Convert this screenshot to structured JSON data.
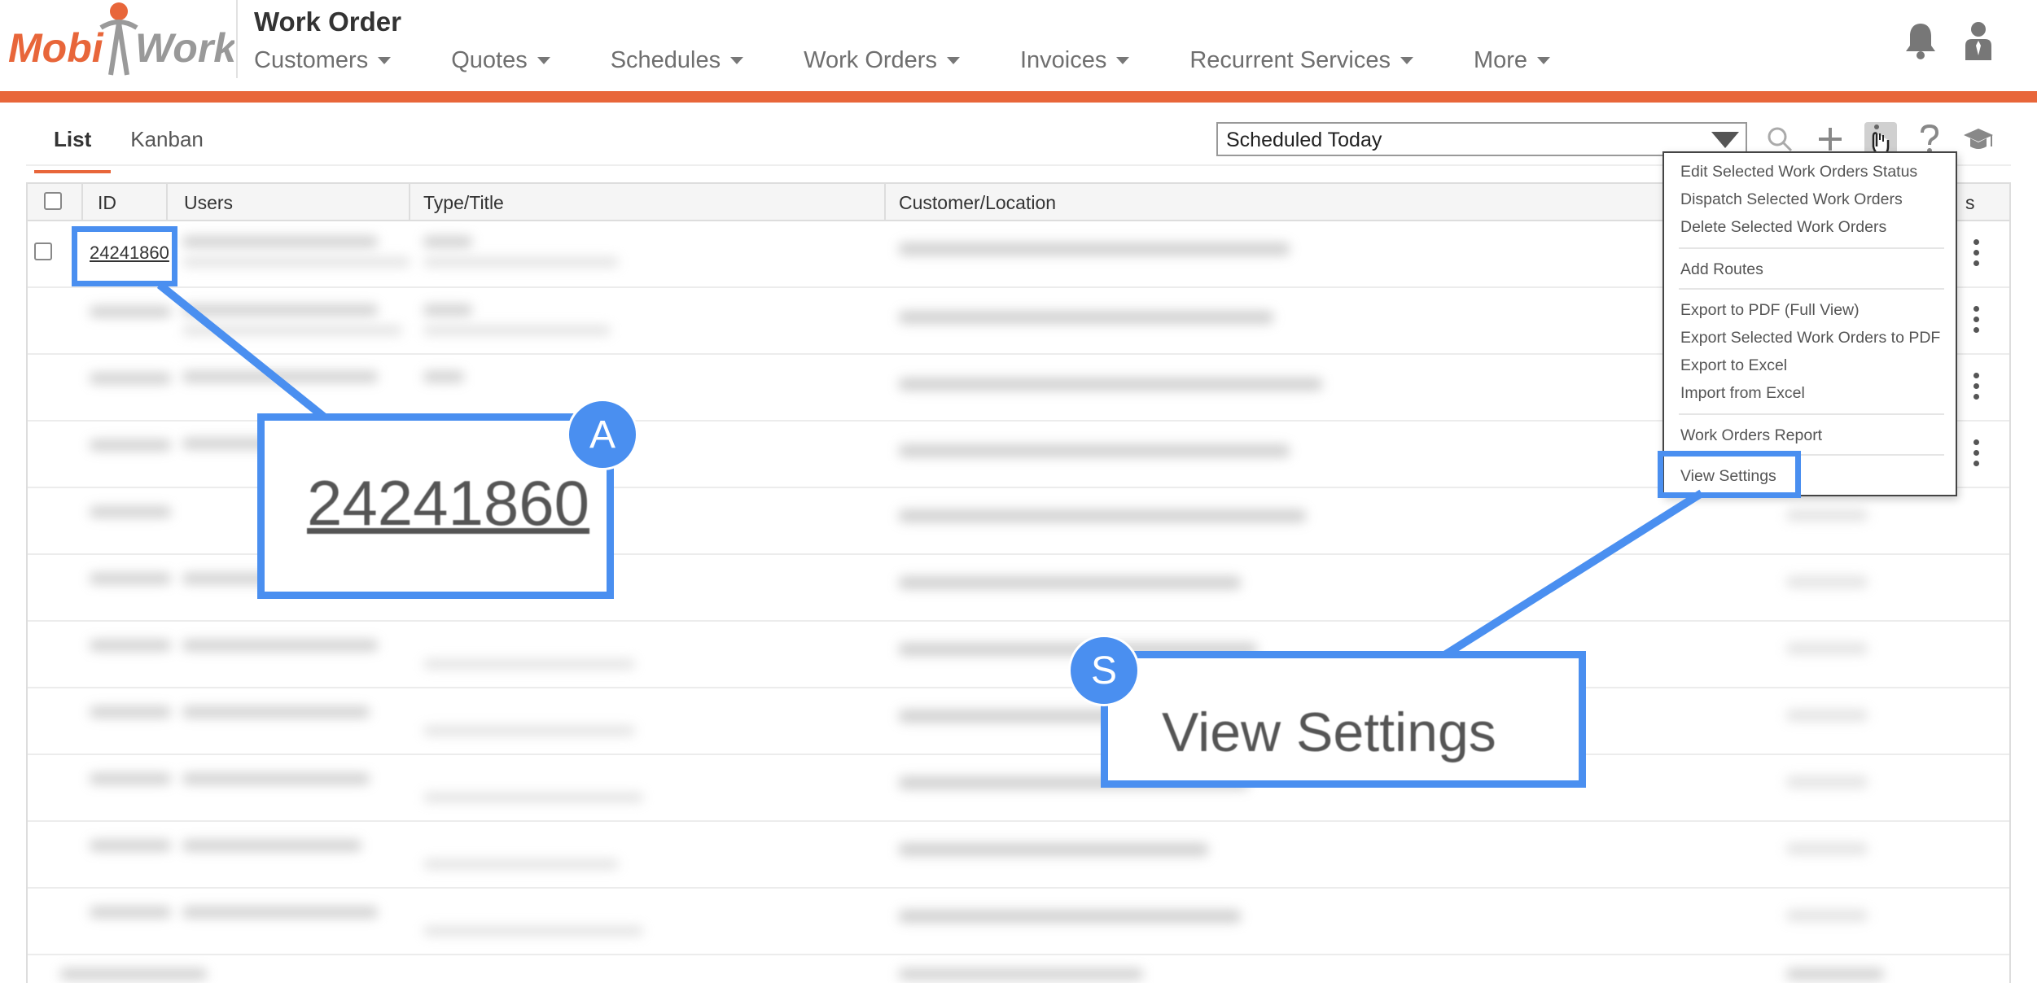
{
  "app": {
    "logo_text_1": "Mobi",
    "logo_text_2": "Work",
    "title": "Work Order"
  },
  "nav": {
    "items": [
      {
        "label": "Customers"
      },
      {
        "label": "Quotes"
      },
      {
        "label": "Schedules"
      },
      {
        "label": "Work Orders"
      },
      {
        "label": "Invoices"
      },
      {
        "label": "Recurrent Services"
      },
      {
        "label": "More"
      }
    ]
  },
  "header_icons": [
    "bell-icon",
    "user-icon"
  ],
  "tabs": [
    {
      "label": "List",
      "active": true
    },
    {
      "label": "Kanban",
      "active": false
    }
  ],
  "view_select": {
    "value": "Scheduled Today"
  },
  "toolbar_icons": [
    "search-icon",
    "plus-icon",
    "more-vertical-icon",
    "help-icon",
    "graduation-cap-icon"
  ],
  "table": {
    "columns": [
      "ID",
      "Users",
      "Type/Title",
      "Customer/Location",
      "s"
    ],
    "first_row_id": "24241860"
  },
  "menu": {
    "items": [
      "Edit Selected Work Orders Status",
      "Dispatch Selected Work Orders",
      "Delete Selected Work Orders",
      "Add Routes",
      "Export to PDF (Full View)",
      "Export Selected Work Orders to PDF",
      "Export to Excel",
      "Import from Excel",
      "Work Orders Report",
      "View Settings"
    ]
  },
  "callouts": {
    "a": {
      "badge": "A",
      "text": "24241860"
    },
    "s": {
      "badge": "S",
      "text": "View Settings"
    }
  },
  "colors": {
    "accent": "#e8663a",
    "callout": "#4a8ff0"
  }
}
